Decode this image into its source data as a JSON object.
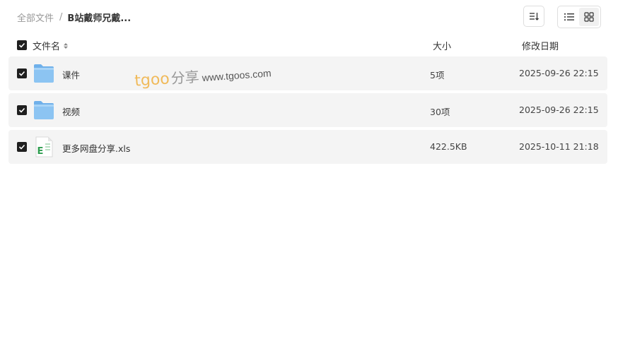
{
  "breadcrumb": {
    "root": "全部文件",
    "separator": "/",
    "current": "B站戴师兄戴..."
  },
  "toolbar": {
    "sort_icon": "sort-icon",
    "list_view_icon": "list-view-icon",
    "grid_view_icon": "grid-view-icon",
    "active_view": "list"
  },
  "header": {
    "name": "文件名",
    "size": "大小",
    "date": "修改日期",
    "select_all_checked": true
  },
  "watermark": {
    "logo": "tgoo",
    "cn": "分享",
    "url": "www.tgoos.com"
  },
  "files": [
    {
      "name": "课件",
      "size": "5项",
      "date": "2025-09-26 22:15",
      "type": "folder",
      "checked": true
    },
    {
      "name": "视频",
      "size": "30项",
      "date": "2025-09-26 22:15",
      "type": "folder",
      "checked": true
    },
    {
      "name": "更多网盘分享.xls",
      "size": "422.5KB",
      "date": "2025-10-11 21:18",
      "type": "excel",
      "checked": true
    }
  ],
  "colors": {
    "folder": "#8cc4f2",
    "excel": "#2e9d4f",
    "checkbox": "#1f1f1f",
    "row_bg": "#f4f4f4"
  }
}
